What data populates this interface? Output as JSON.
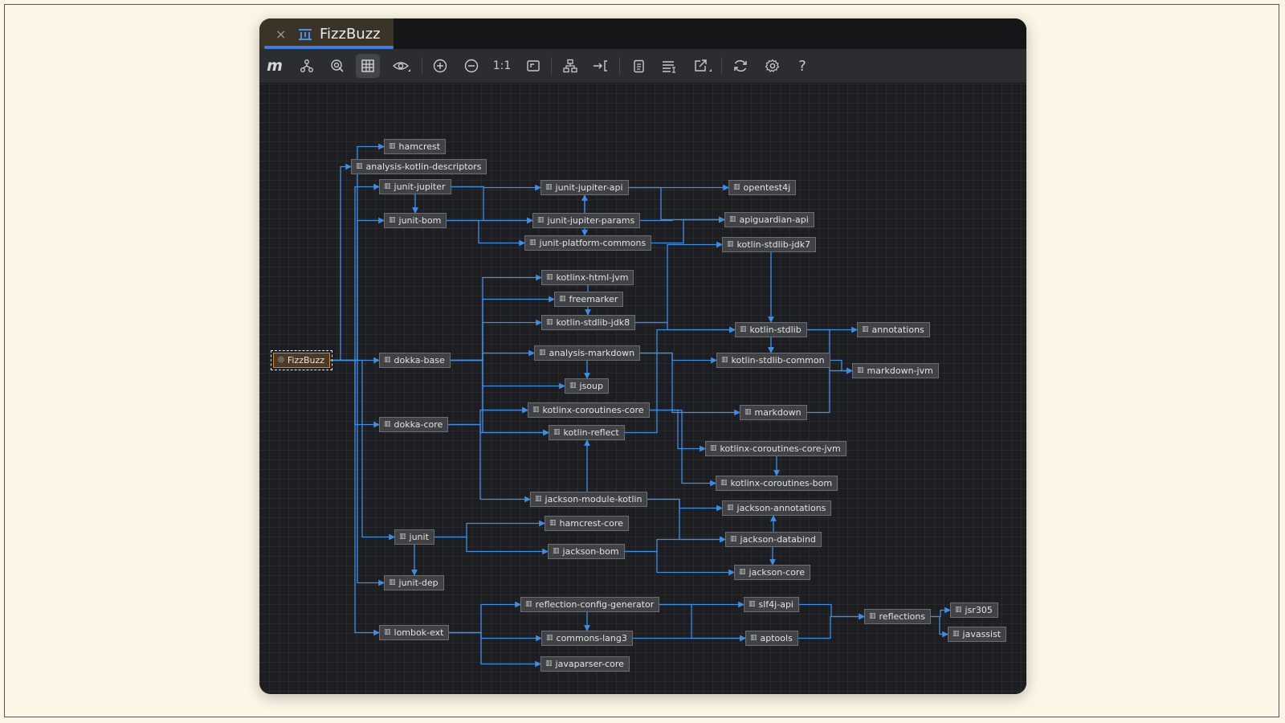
{
  "window": {
    "tab_title": "FizzBuzz",
    "close_glyph": "×",
    "tab_icon": "diagram-icon"
  },
  "toolbar": {
    "logo": "m",
    "actual_size_label": "1:1",
    "help_label": "?",
    "buttons": [
      {
        "name": "logo-button",
        "glyph": "m"
      },
      {
        "name": "dependency-analyzer-button",
        "icon": "hierarchy-icon"
      },
      {
        "name": "select-target-button",
        "icon": "target-icon"
      },
      {
        "name": "show-modules-button",
        "icon": "grid-icon",
        "active": true
      },
      {
        "name": "visibility-button",
        "icon": "eye-icon"
      },
      {
        "name": "zoom-in-button",
        "icon": "zoom-in-icon"
      },
      {
        "name": "zoom-out-button",
        "icon": "zoom-out-icon"
      },
      {
        "name": "actual-size-button",
        "glyph": "1:1"
      },
      {
        "name": "fit-content-button",
        "icon": "fit-icon"
      },
      {
        "name": "layout-button",
        "icon": "tree-layout-icon"
      },
      {
        "name": "route-edges-button",
        "icon": "route-icon"
      },
      {
        "name": "copy-button",
        "icon": "clipboard-icon"
      },
      {
        "name": "options-button",
        "icon": "list-icon"
      },
      {
        "name": "export-button",
        "icon": "export-icon"
      },
      {
        "name": "refresh-button",
        "icon": "refresh-icon"
      },
      {
        "name": "settings-button",
        "icon": "gear-icon"
      },
      {
        "name": "help-button",
        "glyph": "?"
      }
    ]
  },
  "graph": {
    "edge_color": "#3f8ee6",
    "node_icon": "library-icon",
    "root": "FizzBuzz",
    "nodes": [
      {
        "id": "FizzBuzz",
        "label": "FizzBuzz",
        "root": true
      },
      {
        "id": "hamcrest",
        "label": "hamcrest"
      },
      {
        "id": "akd",
        "label": "analysis-kotlin-descriptors"
      },
      {
        "id": "jj",
        "label": "junit-jupiter"
      },
      {
        "id": "jbom",
        "label": "junit-bom"
      },
      {
        "id": "jjapi",
        "label": "junit-jupiter-api"
      },
      {
        "id": "jjparams",
        "label": "junit-jupiter-params"
      },
      {
        "id": "jpc",
        "label": "junit-platform-commons"
      },
      {
        "id": "ot4j",
        "label": "opentest4j"
      },
      {
        "id": "apig",
        "label": "apiguardian-api"
      },
      {
        "id": "ksjdk7",
        "label": "kotlin-stdlib-jdk7"
      },
      {
        "id": "khtml",
        "label": "kotlinx-html-jvm"
      },
      {
        "id": "fm",
        "label": "freemarker"
      },
      {
        "id": "ksjdk8",
        "label": "kotlin-stdlib-jdk8"
      },
      {
        "id": "am",
        "label": "analysis-markdown"
      },
      {
        "id": "jsoup",
        "label": "jsoup"
      },
      {
        "id": "kcc",
        "label": "kotlinx-coroutines-core"
      },
      {
        "id": "kr",
        "label": "kotlin-reflect"
      },
      {
        "id": "ks",
        "label": "kotlin-stdlib"
      },
      {
        "id": "ksc",
        "label": "kotlin-stdlib-common"
      },
      {
        "id": "ann",
        "label": "annotations"
      },
      {
        "id": "mdjvm",
        "label": "markdown-jvm"
      },
      {
        "id": "md",
        "label": "markdown"
      },
      {
        "id": "kccjvm",
        "label": "kotlinx-coroutines-core-jvm"
      },
      {
        "id": "kcbom",
        "label": "kotlinx-coroutines-bom"
      },
      {
        "id": "db",
        "label": "dokka-base"
      },
      {
        "id": "dc",
        "label": "dokka-core"
      },
      {
        "id": "jmk",
        "label": "jackson-module-kotlin"
      },
      {
        "id": "jann",
        "label": "jackson-annotations"
      },
      {
        "id": "hcore",
        "label": "hamcrest-core"
      },
      {
        "id": "jdb",
        "label": "jackson-databind"
      },
      {
        "id": "junit",
        "label": "junit"
      },
      {
        "id": "jackbom",
        "label": "jackson-bom"
      },
      {
        "id": "jcore",
        "label": "jackson-core"
      },
      {
        "id": "jdep",
        "label": "junit-dep"
      },
      {
        "id": "rcg",
        "label": "reflection-config-generator"
      },
      {
        "id": "slf",
        "label": "slf4j-api"
      },
      {
        "id": "refl",
        "label": "reflections"
      },
      {
        "id": "jsr",
        "label": "jsr305"
      },
      {
        "id": "lombok",
        "label": "lombok-ext"
      },
      {
        "id": "cl3",
        "label": "commons-lang3"
      },
      {
        "id": "apt",
        "label": "aptools"
      },
      {
        "id": "jav",
        "label": "javassist"
      },
      {
        "id": "jpcore",
        "label": "javaparser-core"
      }
    ],
    "edges": [
      [
        "FizzBuzz",
        "hamcrest"
      ],
      [
        "FizzBuzz",
        "akd"
      ],
      [
        "FizzBuzz",
        "jj"
      ],
      [
        "FizzBuzz",
        "jbom"
      ],
      [
        "FizzBuzz",
        "db"
      ],
      [
        "FizzBuzz",
        "dc"
      ],
      [
        "FizzBuzz",
        "junit"
      ],
      [
        "FizzBuzz",
        "jdep"
      ],
      [
        "FizzBuzz",
        "lombok"
      ],
      [
        "jj",
        "jjapi"
      ],
      [
        "jj",
        "jjparams"
      ],
      [
        "jj",
        "jbom"
      ],
      [
        "jbom",
        "jjparams"
      ],
      [
        "jbom",
        "jpc"
      ],
      [
        "jjapi",
        "ot4j"
      ],
      [
        "jjapi",
        "apig"
      ],
      [
        "jjapi",
        "jpc"
      ],
      [
        "jjparams",
        "jjapi"
      ],
      [
        "jjparams",
        "apig"
      ],
      [
        "jpc",
        "apig"
      ],
      [
        "db",
        "khtml"
      ],
      [
        "db",
        "fm"
      ],
      [
        "db",
        "ksjdk8"
      ],
      [
        "db",
        "am"
      ],
      [
        "db",
        "jsoup"
      ],
      [
        "db",
        "kcc"
      ],
      [
        "db",
        "kr"
      ],
      [
        "dc",
        "kcc"
      ],
      [
        "dc",
        "kr"
      ],
      [
        "dc",
        "jmk"
      ],
      [
        "khtml",
        "ksjdk8"
      ],
      [
        "ksjdk8",
        "ksjdk7"
      ],
      [
        "ksjdk8",
        "ks"
      ],
      [
        "ksjdk7",
        "ks"
      ],
      [
        "am",
        "md"
      ],
      [
        "am",
        "jsoup"
      ],
      [
        "am",
        "ksc"
      ],
      [
        "ks",
        "ann"
      ],
      [
        "ks",
        "ksc"
      ],
      [
        "ks",
        "mdjvm"
      ],
      [
        "ksc",
        "mdjvm"
      ],
      [
        "md",
        "mdjvm"
      ],
      [
        "kcc",
        "kccjvm"
      ],
      [
        "kcc",
        "kcbom"
      ],
      [
        "kccjvm",
        "kcbom"
      ],
      [
        "kr",
        "ks"
      ],
      [
        "jmk",
        "kr"
      ],
      [
        "jmk",
        "jann"
      ],
      [
        "jmk",
        "jdb"
      ],
      [
        "jdb",
        "jann"
      ],
      [
        "jdb",
        "jcore"
      ],
      [
        "junit",
        "hcore"
      ],
      [
        "junit",
        "jackbom"
      ],
      [
        "junit",
        "jdep"
      ],
      [
        "jackbom",
        "jdb"
      ],
      [
        "jackbom",
        "jcore"
      ],
      [
        "lombok",
        "rcg"
      ],
      [
        "lombok",
        "cl3"
      ],
      [
        "lombok",
        "jpcore"
      ],
      [
        "rcg",
        "cl3"
      ],
      [
        "rcg",
        "slf"
      ],
      [
        "rcg",
        "apt"
      ],
      [
        "cl3",
        "apt"
      ],
      [
        "slf",
        "refl"
      ],
      [
        "apt",
        "refl"
      ],
      [
        "refl",
        "jsr"
      ],
      [
        "refl",
        "jav"
      ]
    ]
  }
}
